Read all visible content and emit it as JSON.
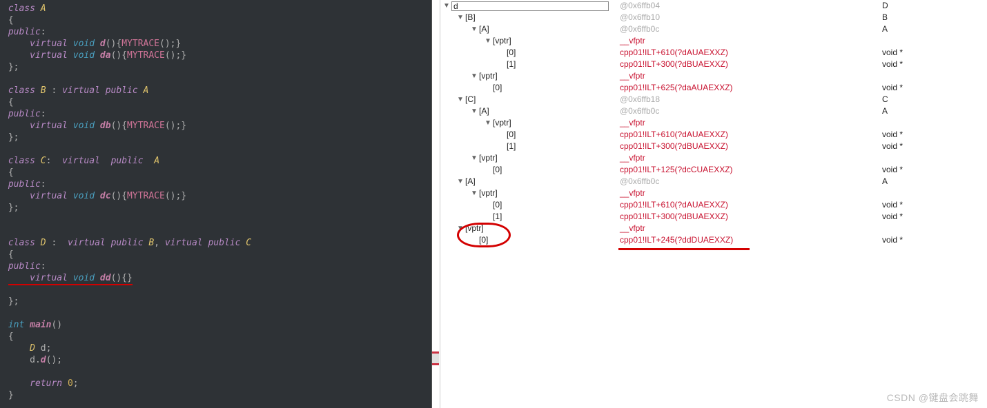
{
  "watermark": "CSDN @键盘会跳舞",
  "code": {
    "lines": [
      {
        "raw": "class A",
        "tokens": [
          [
            "kw",
            "class"
          ],
          [
            " ",
            " "
          ],
          [
            "typ",
            "A"
          ]
        ]
      },
      {
        "raw": "{",
        "tokens": [
          [
            "br",
            "{"
          ]
        ]
      },
      {
        "raw": "public:",
        "tokens": [
          [
            "pub",
            "public"
          ],
          [
            "br",
            ":"
          ]
        ]
      },
      {
        "raw": "    virtual void d(){MYTRACE();}",
        "tokens": [
          [
            "",
            "    "
          ],
          [
            "kw",
            "virtual"
          ],
          [
            " ",
            " "
          ],
          [
            "fn",
            "void"
          ],
          [
            " ",
            " "
          ],
          [
            "fnb",
            "d"
          ],
          [
            "br",
            "()"
          ],
          [
            "br",
            "{"
          ],
          [
            "mac",
            "MYTRACE"
          ],
          [
            "br",
            "();}"
          ]
        ]
      },
      {
        "raw": "    virtual void da(){MYTRACE();}",
        "tokens": [
          [
            "",
            "    "
          ],
          [
            "kw",
            "virtual"
          ],
          [
            " ",
            " "
          ],
          [
            "fn",
            "void"
          ],
          [
            " ",
            " "
          ],
          [
            "fnb",
            "da"
          ],
          [
            "br",
            "()"
          ],
          [
            "br",
            "{"
          ],
          [
            "mac",
            "MYTRACE"
          ],
          [
            "br",
            "();}"
          ]
        ]
      },
      {
        "raw": "};",
        "tokens": [
          [
            "br",
            "};"
          ]
        ]
      },
      {
        "raw": "",
        "tokens": []
      },
      {
        "raw": "class B : virtual public A",
        "tokens": [
          [
            "kw",
            "class"
          ],
          [
            " ",
            " "
          ],
          [
            "typ",
            "B"
          ],
          [
            " ",
            " "
          ],
          [
            "br",
            ":"
          ],
          [
            " ",
            " "
          ],
          [
            "kw",
            "virtual"
          ],
          [
            " ",
            " "
          ],
          [
            "kw",
            "public"
          ],
          [
            " ",
            " "
          ],
          [
            "typ",
            "A"
          ]
        ]
      },
      {
        "raw": "{",
        "tokens": [
          [
            "br",
            "{"
          ]
        ]
      },
      {
        "raw": "public:",
        "tokens": [
          [
            "pub",
            "public"
          ],
          [
            "br",
            ":"
          ]
        ]
      },
      {
        "raw": "    virtual void db(){MYTRACE();}",
        "tokens": [
          [
            "",
            "    "
          ],
          [
            "kw",
            "virtual"
          ],
          [
            " ",
            " "
          ],
          [
            "fn",
            "void"
          ],
          [
            " ",
            " "
          ],
          [
            "fnb",
            "db"
          ],
          [
            "br",
            "()"
          ],
          [
            "br",
            "{"
          ],
          [
            "mac",
            "MYTRACE"
          ],
          [
            "br",
            "();}"
          ]
        ]
      },
      {
        "raw": "};",
        "tokens": [
          [
            "br",
            "};"
          ]
        ]
      },
      {
        "raw": "",
        "tokens": []
      },
      {
        "raw": "class C:  virtual  public  A",
        "tokens": [
          [
            "kw",
            "class"
          ],
          [
            " ",
            " "
          ],
          [
            "typ",
            "C"
          ],
          [
            "br",
            ":"
          ],
          [
            "",
            "  "
          ],
          [
            "kw",
            "virtual"
          ],
          [
            "",
            "  "
          ],
          [
            "kw",
            "public"
          ],
          [
            "",
            "  "
          ],
          [
            "typ",
            "A"
          ]
        ]
      },
      {
        "raw": "{",
        "tokens": [
          [
            "br",
            "{"
          ]
        ]
      },
      {
        "raw": "public:",
        "tokens": [
          [
            "pub",
            "public"
          ],
          [
            "br",
            ":"
          ]
        ]
      },
      {
        "raw": "    virtual void dc(){MYTRACE();}",
        "tokens": [
          [
            "",
            "    "
          ],
          [
            "kw",
            "virtual"
          ],
          [
            " ",
            " "
          ],
          [
            "fn",
            "void"
          ],
          [
            " ",
            " "
          ],
          [
            "fnb",
            "dc"
          ],
          [
            "br",
            "()"
          ],
          [
            "br",
            "{"
          ],
          [
            "mac",
            "MYTRACE"
          ],
          [
            "br",
            "();}"
          ]
        ]
      },
      {
        "raw": "};",
        "tokens": [
          [
            "br",
            "};"
          ]
        ]
      },
      {
        "raw": "",
        "tokens": []
      },
      {
        "raw": "",
        "tokens": []
      },
      {
        "raw": "class D :  virtual public B, virtual public C",
        "tokens": [
          [
            "kw",
            "class"
          ],
          [
            " ",
            " "
          ],
          [
            "typ",
            "D"
          ],
          [
            " ",
            " "
          ],
          [
            "br",
            ":"
          ],
          [
            "",
            "  "
          ],
          [
            "kw",
            "virtual"
          ],
          [
            " ",
            " "
          ],
          [
            "kw",
            "public"
          ],
          [
            " ",
            " "
          ],
          [
            "typ",
            "B"
          ],
          [
            "br",
            ","
          ],
          [
            " ",
            " "
          ],
          [
            "kw",
            "virtual"
          ],
          [
            " ",
            " "
          ],
          [
            "kw",
            "public"
          ],
          [
            " ",
            " "
          ],
          [
            "typ",
            "C"
          ]
        ]
      },
      {
        "raw": "{",
        "tokens": [
          [
            "br",
            "{"
          ]
        ]
      },
      {
        "raw": "public:",
        "tokens": [
          [
            "pub",
            "public"
          ],
          [
            "br",
            ":"
          ]
        ]
      },
      {
        "raw": "    virtual void dd(){}",
        "tokens": [
          [
            "",
            "    "
          ],
          [
            "kw",
            "virtual"
          ],
          [
            " ",
            " "
          ],
          [
            "fn",
            "void"
          ],
          [
            " ",
            " "
          ],
          [
            "fnb",
            "dd"
          ],
          [
            "br",
            "()"
          ],
          [
            "br",
            "{}"
          ]
        ],
        "underline": true
      },
      {
        "raw": "",
        "tokens": []
      },
      {
        "raw": "};",
        "tokens": [
          [
            "br",
            "};"
          ]
        ]
      },
      {
        "raw": "",
        "tokens": []
      },
      {
        "raw": "int main()",
        "tokens": [
          [
            "fn",
            "int"
          ],
          [
            " ",
            " "
          ],
          [
            "fnb",
            "main"
          ],
          [
            "br",
            "()"
          ]
        ]
      },
      {
        "raw": "{",
        "tokens": [
          [
            "br",
            "{"
          ]
        ]
      },
      {
        "raw": "    D d;",
        "tokens": [
          [
            "",
            "    "
          ],
          [
            "typ",
            "D"
          ],
          [
            " ",
            " "
          ],
          [
            "",
            "d"
          ],
          [
            "br",
            ";"
          ]
        ]
      },
      {
        "raw": "    d.d();",
        "tokens": [
          [
            "",
            "    "
          ],
          [
            "",
            "d"
          ],
          [
            "br",
            "."
          ],
          [
            "fnb",
            "d"
          ],
          [
            "br",
            "();"
          ]
        ]
      },
      {
        "raw": "",
        "tokens": []
      },
      {
        "raw": "    return 0;",
        "tokens": [
          [
            "",
            "    "
          ],
          [
            "kw",
            "return"
          ],
          [
            " ",
            " "
          ],
          [
            "num",
            "0"
          ],
          [
            "br",
            ";"
          ]
        ]
      },
      {
        "raw": "}",
        "tokens": [
          [
            "br",
            "}"
          ]
        ]
      }
    ]
  },
  "watch": {
    "rows": [
      {
        "depth": 0,
        "exp": true,
        "name": "d",
        "value": "@0x6ffb04",
        "vcls": "grey",
        "type": "D",
        "boxed": true
      },
      {
        "depth": 1,
        "exp": true,
        "name": "[B]",
        "value": "@0x6ffb10",
        "vcls": "grey",
        "type": "B"
      },
      {
        "depth": 2,
        "exp": true,
        "name": "[A]",
        "value": "@0x6ffb0c",
        "vcls": "grey",
        "type": "A"
      },
      {
        "depth": 3,
        "exp": true,
        "name": "[vptr]",
        "value": "__vfptr",
        "vcls": "red",
        "type": ""
      },
      {
        "depth": 4,
        "exp": null,
        "name": "[0]",
        "value": "cpp01!ILT+610(?dAUAEXXZ)",
        "vcls": "red",
        "type": "void *"
      },
      {
        "depth": 4,
        "exp": null,
        "name": "[1]",
        "value": "cpp01!ILT+300(?dBUAEXXZ)",
        "vcls": "red",
        "type": "void *"
      },
      {
        "depth": 2,
        "exp": true,
        "name": "[vptr]",
        "value": "__vfptr",
        "vcls": "red",
        "type": ""
      },
      {
        "depth": 3,
        "exp": null,
        "name": "[0]",
        "value": "cpp01!ILT+625(?daAUAEXXZ)",
        "vcls": "red",
        "type": "void *"
      },
      {
        "depth": 1,
        "exp": true,
        "name": "[C]",
        "value": "@0x6ffb18",
        "vcls": "grey",
        "type": "C"
      },
      {
        "depth": 2,
        "exp": true,
        "name": "[A]",
        "value": "@0x6ffb0c",
        "vcls": "grey",
        "type": "A"
      },
      {
        "depth": 3,
        "exp": true,
        "name": "[vptr]",
        "value": "__vfptr",
        "vcls": "red",
        "type": ""
      },
      {
        "depth": 4,
        "exp": null,
        "name": "[0]",
        "value": "cpp01!ILT+610(?dAUAEXXZ)",
        "vcls": "red",
        "type": "void *"
      },
      {
        "depth": 4,
        "exp": null,
        "name": "[1]",
        "value": "cpp01!ILT+300(?dBUAEXXZ)",
        "vcls": "red",
        "type": "void *"
      },
      {
        "depth": 2,
        "exp": true,
        "name": "[vptr]",
        "value": "__vfptr",
        "vcls": "red",
        "type": ""
      },
      {
        "depth": 3,
        "exp": null,
        "name": "[0]",
        "value": "cpp01!ILT+125(?dcCUAEXXZ)",
        "vcls": "red",
        "type": "void *"
      },
      {
        "depth": 1,
        "exp": true,
        "name": "[A]",
        "value": "@0x6ffb0c",
        "vcls": "grey",
        "type": "A"
      },
      {
        "depth": 2,
        "exp": true,
        "name": "[vptr]",
        "value": "__vfptr",
        "vcls": "red",
        "type": ""
      },
      {
        "depth": 3,
        "exp": null,
        "name": "[0]",
        "value": "cpp01!ILT+610(?dAUAEXXZ)",
        "vcls": "red",
        "type": "void *"
      },
      {
        "depth": 3,
        "exp": null,
        "name": "[1]",
        "value": "cpp01!ILT+300(?dBUAEXXZ)",
        "vcls": "red",
        "type": "void *"
      },
      {
        "depth": 1,
        "exp": true,
        "name": "[vptr]",
        "value": "__vfptr",
        "vcls": "red",
        "type": ""
      },
      {
        "depth": 2,
        "exp": null,
        "name": "[0]",
        "value": "cpp01!ILT+245(?ddDUAEXXZ)",
        "vcls": "red",
        "type": "void *"
      }
    ]
  }
}
